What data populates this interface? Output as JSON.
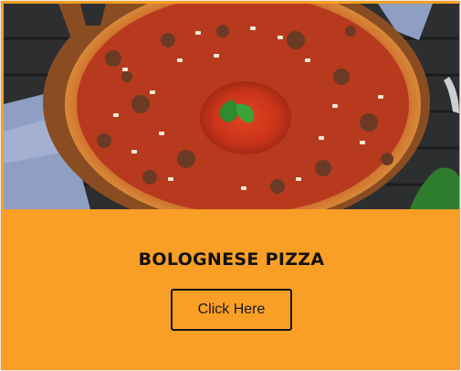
{
  "card": {
    "image_alt": "Bolognese pizza",
    "title": "BOLOGNESE PIZZA",
    "button_label": "Click Here"
  },
  "colors": {
    "card_background": "#f99f26",
    "text": "#111111",
    "button_border": "#111111"
  }
}
